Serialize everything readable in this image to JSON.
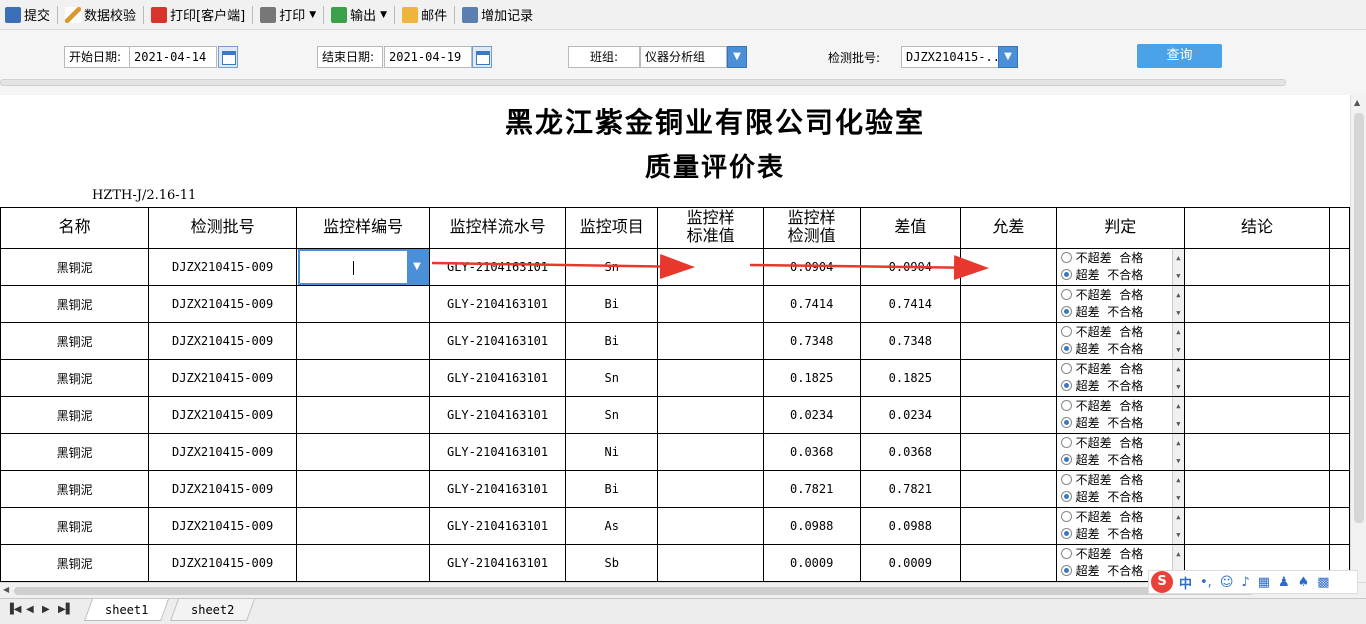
{
  "toolbar": {
    "submit": "提交",
    "validate": "数据校验",
    "print_client": "打印[客户端]",
    "print": "打印",
    "export": "输出",
    "mail": "邮件",
    "add_record": "增加记录"
  },
  "filters": {
    "start_label": "开始日期:",
    "start_value": "2021-04-14",
    "end_label": "结束日期:",
    "end_value": "2021-04-19",
    "group_label": "班组:",
    "group_value": "仪器分析组",
    "batch_label": "检测批号:",
    "batch_value": "DJZX210415-...",
    "query_button": "查询"
  },
  "report": {
    "title": "黑龙江紫金铜业有限公司化验室",
    "subtitle": "质量评价表",
    "doc_no": "HZTH-J/2.16-11"
  },
  "table": {
    "headers": [
      "名称",
      "检测批号",
      "监控样编号",
      "监控样流水号",
      "监控项目",
      "监控样\n标准值",
      "监控样\n检测值",
      "差值",
      "允差",
      "判定",
      "结论"
    ],
    "radio_options": [
      "不超差  合格",
      "超差  不合格"
    ],
    "rows": [
      {
        "name": "黑铜泥",
        "batch": "DJZX210415-009",
        "sample_no": "",
        "serial": "GLY-2104163101",
        "item": "Sn",
        "std": "",
        "measured": "0.0904",
        "diff": "0.0904",
        "tol": "",
        "judge_selected": 1,
        "conclusion": ""
      },
      {
        "name": "黑铜泥",
        "batch": "DJZX210415-009",
        "sample_no": "",
        "serial": "GLY-2104163101",
        "item": "Bi",
        "std": "",
        "measured": "0.7414",
        "diff": "0.7414",
        "tol": "",
        "judge_selected": 1,
        "conclusion": ""
      },
      {
        "name": "黑铜泥",
        "batch": "DJZX210415-009",
        "sample_no": "",
        "serial": "GLY-2104163101",
        "item": "Bi",
        "std": "",
        "measured": "0.7348",
        "diff": "0.7348",
        "tol": "",
        "judge_selected": 1,
        "conclusion": ""
      },
      {
        "name": "黑铜泥",
        "batch": "DJZX210415-009",
        "sample_no": "",
        "serial": "GLY-2104163101",
        "item": "Sn",
        "std": "",
        "measured": "0.1825",
        "diff": "0.1825",
        "tol": "",
        "judge_selected": 1,
        "conclusion": ""
      },
      {
        "name": "黑铜泥",
        "batch": "DJZX210415-009",
        "sample_no": "",
        "serial": "GLY-2104163101",
        "item": "Sn",
        "std": "",
        "measured": "0.0234",
        "diff": "0.0234",
        "tol": "",
        "judge_selected": 1,
        "conclusion": ""
      },
      {
        "name": "黑铜泥",
        "batch": "DJZX210415-009",
        "sample_no": "",
        "serial": "GLY-2104163101",
        "item": "Ni",
        "std": "",
        "measured": "0.0368",
        "diff": "0.0368",
        "tol": "",
        "judge_selected": 1,
        "conclusion": ""
      },
      {
        "name": "黑铜泥",
        "batch": "DJZX210415-009",
        "sample_no": "",
        "serial": "GLY-2104163101",
        "item": "Bi",
        "std": "",
        "measured": "0.7821",
        "diff": "0.7821",
        "tol": "",
        "judge_selected": 1,
        "conclusion": ""
      },
      {
        "name": "黑铜泥",
        "batch": "DJZX210415-009",
        "sample_no": "",
        "serial": "GLY-2104163101",
        "item": "As",
        "std": "",
        "measured": "0.0988",
        "diff": "0.0988",
        "tol": "",
        "judge_selected": 1,
        "conclusion": ""
      },
      {
        "name": "黑铜泥",
        "batch": "DJZX210415-009",
        "sample_no": "",
        "serial": "GLY-2104163101",
        "item": "Sb",
        "std": "",
        "measured": "0.0009",
        "diff": "0.0009",
        "tol": "",
        "judge_selected": 1,
        "conclusion": ""
      }
    ]
  },
  "sheets": [
    "sheet1",
    "sheet2"
  ],
  "ime": {
    "logo": "S",
    "mode": "中",
    "punct": "•,"
  },
  "colors": {
    "accent": "#4a8fd8",
    "arrow": "#e8372c",
    "query": "#4aa3e8"
  }
}
